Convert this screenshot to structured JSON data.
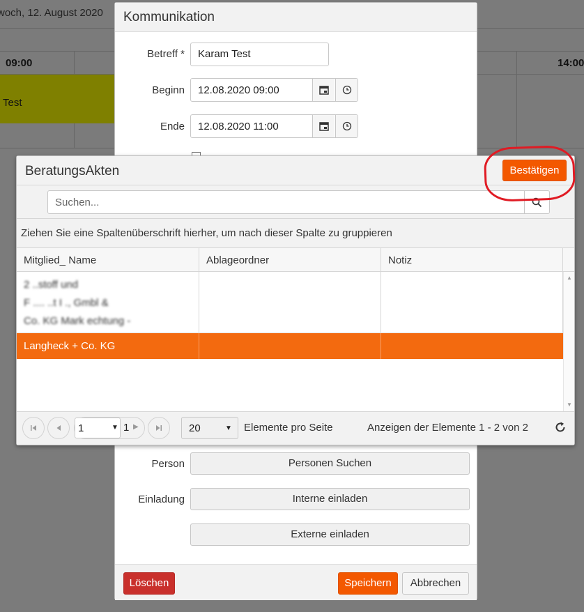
{
  "calendar": {
    "date": "woch, 12. August 2020",
    "time_left": "09:00",
    "time_right": "14:00",
    "event_label": "Test",
    "event_color": "#7f8000"
  },
  "kommunikation": {
    "title": "Kommunikation",
    "betreff_label": "Betreff *",
    "betreff_value": "Karam Test",
    "beginn_label": "Beginn",
    "beginn_value": "12.08.2020 09:00",
    "ende_label": "Ende",
    "ende_value": "12.08.2020 11:00",
    "person_label": "Person",
    "person_button": "Personen Suchen",
    "einladung_label": "Einladung",
    "intern_button": "Interne einladen",
    "extern_button": "Externe einladen",
    "delete_button": "Löschen",
    "save_button": "Speichern",
    "cancel_button": "Abbrechen"
  },
  "beratungsakten": {
    "title": "BeratungsAkten",
    "confirm_button": "Bestätigen",
    "search_placeholder": "Suchen...",
    "group_hint": "Ziehen Sie eine Spaltenüberschrift hierher, um nach dieser Spalte zu gruppieren",
    "columns": [
      "Mitglied_ Name",
      "Ablageordner",
      "Notiz"
    ],
    "rows": [
      {
        "lines": [
          "2  ..stoff   und",
          "F         ....  ..t  I   ., Gmbl  &",
          "Co. KG  Mark      echtung  -"
        ],
        "ablage": "",
        "notiz": "",
        "selected": false,
        "redacted": true
      },
      {
        "name": "Langheck + Co. KG",
        "ablage": "",
        "notiz": "",
        "selected": true
      }
    ],
    "pager": {
      "page": "1",
      "total_pages": "1",
      "page_size": "20",
      "per_page_label": "Elemente pro Seite",
      "info": "Anzeigen der Elemente 1 - 2 von 2"
    },
    "accent_color": "#f35800"
  },
  "annotation": {
    "color": "#e01b24"
  }
}
